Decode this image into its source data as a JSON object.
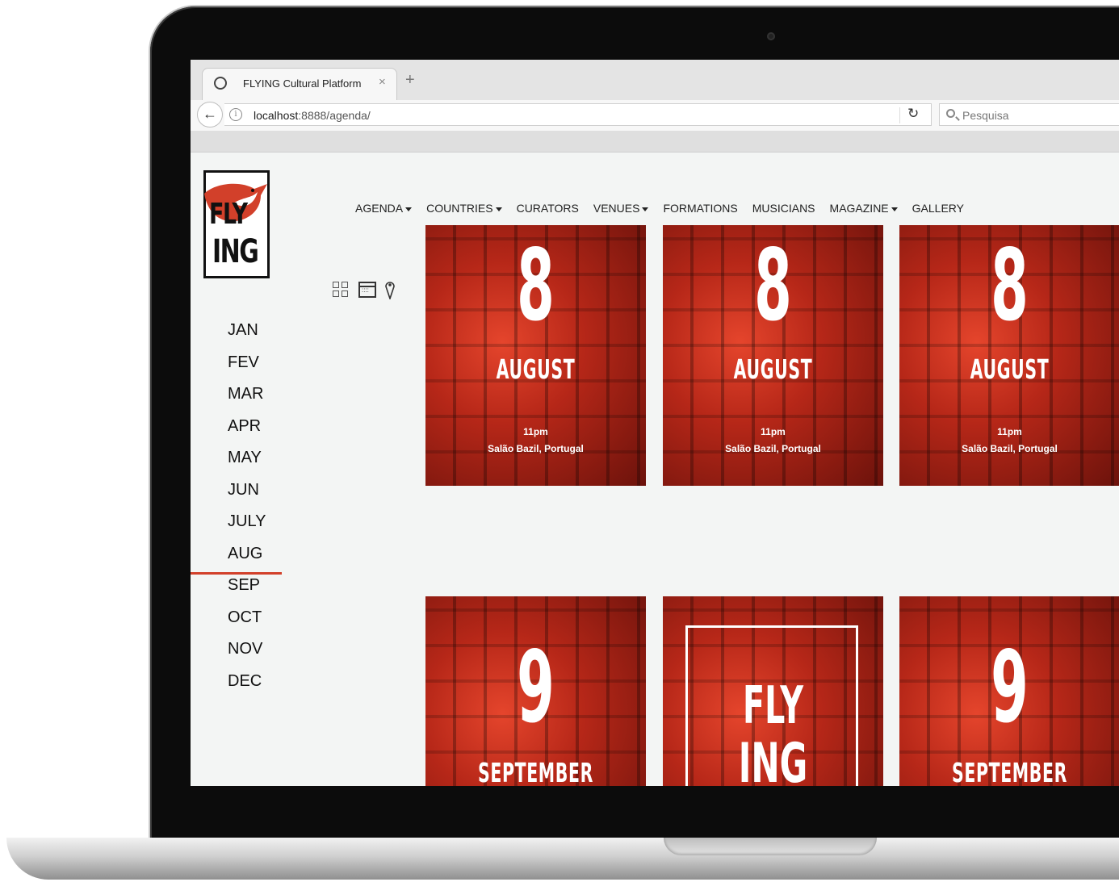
{
  "browser": {
    "tab_title": "FLYING Cultural Platform",
    "tab_close": "×",
    "new_tab": "+",
    "url_host": "localhost",
    "url_rest": ":8888/agenda/",
    "search_placeholder": "Pesquisa"
  },
  "site": {
    "logo_line1": "FLY",
    "logo_line2": "ING",
    "nav": [
      {
        "label": "AGENDA",
        "dropdown": true
      },
      {
        "label": "COUNTRIES",
        "dropdown": true
      },
      {
        "label": "CURATORS",
        "dropdown": false
      },
      {
        "label": "VENUES",
        "dropdown": true
      },
      {
        "label": "FORMATIONS",
        "dropdown": false
      },
      {
        "label": "MUSICIANS",
        "dropdown": false
      },
      {
        "label": "MAGAZINE",
        "dropdown": true
      },
      {
        "label": "GALLERY",
        "dropdown": false
      }
    ],
    "months": [
      "JAN",
      "FEV",
      "MAR",
      "APR",
      "MAY",
      "JUN",
      "JULY",
      "AUG",
      "SEP",
      "OCT",
      "NOV",
      "DEC"
    ],
    "active_month": "AUG"
  },
  "events": [
    {
      "day": "8",
      "month": "AUGUST",
      "time": "11pm",
      "place": "Salão Bazil, Portugal"
    },
    {
      "day": "8",
      "month": "AUGUST",
      "time": "11pm",
      "place": "Salão Bazil, Portugal"
    },
    {
      "day": "8",
      "month": "AUGUST",
      "time": "11pm",
      "place": "Salão Bazil, Portugal"
    },
    {
      "day": "9",
      "month": "SEPTEMBER"
    },
    {
      "logo_line1": "FLY",
      "logo_line2": "ING"
    },
    {
      "day": "9",
      "month": "SEPTEMBER"
    }
  ],
  "colors": {
    "accent": "#d2402a",
    "card_red": "#b62718"
  }
}
